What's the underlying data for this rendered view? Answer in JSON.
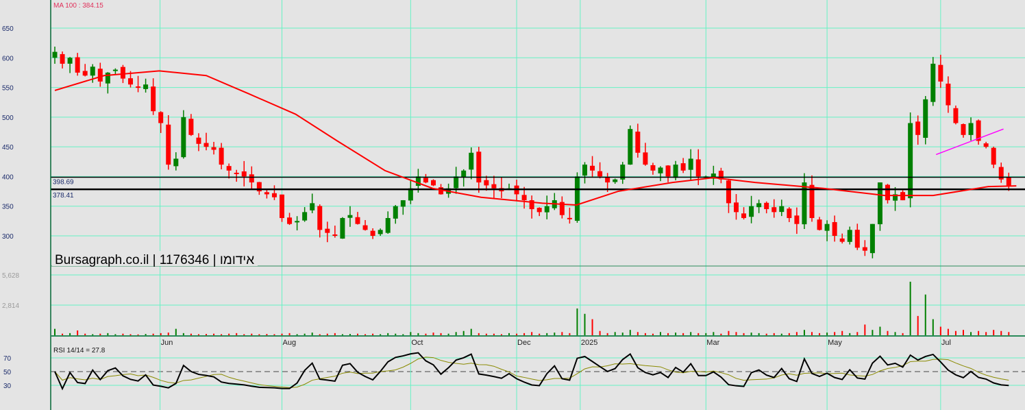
{
  "chart_data": {
    "type": "candlestick",
    "title": "Bursagraph.co.il | 1176346 | אידומו",
    "ma_label": "MA 100 : 384.15",
    "rsi_label": "RSI 14/14 = 27.8",
    "price_ticks": [
      650,
      600,
      550,
      500,
      450,
      400,
      350,
      300
    ],
    "ylim": [
      270,
      690
    ],
    "volume_ticks": [
      "5,628",
      "2,814"
    ],
    "volume_tick_values": [
      5628,
      2814
    ],
    "rsi_ticks": [
      70,
      50,
      30
    ],
    "date_labels": [
      {
        "label": "Jun",
        "index": 13.9
      },
      {
        "label": "Aug",
        "index": 30
      },
      {
        "label": "Oct",
        "index": 47
      },
      {
        "label": "Dec",
        "index": 61
      },
      {
        "label": "2025",
        "index": 69.4
      },
      {
        "label": "Mar",
        "index": 86
      },
      {
        "label": "May",
        "index": 102
      },
      {
        "label": "Jul",
        "index": 117
      }
    ],
    "levels": [
      {
        "label": "398.69",
        "value": 398.69
      },
      {
        "label": "378.41",
        "value": 378.41
      }
    ],
    "trendline": [
      [
        116.4,
        437
      ],
      [
        125.3,
        480
      ]
    ],
    "closes": [
      610,
      590,
      600,
      575,
      570,
      585,
      560,
      575,
      580,
      565,
      555,
      550,
      555,
      510,
      490,
      420,
      430,
      500,
      470,
      455,
      450,
      445,
      420,
      410,
      405,
      400,
      390,
      375,
      370,
      365,
      330,
      320,
      325,
      340,
      355,
      310,
      305,
      300,
      330,
      335,
      320,
      310,
      300,
      310,
      330,
      350,
      360,
      380,
      400,
      390,
      385,
      370,
      380,
      400,
      410,
      440,
      390,
      385,
      380,
      375,
      380,
      370,
      360,
      345,
      340,
      350,
      360,
      335,
      330,
      400,
      420,
      410,
      400,
      390,
      395,
      420,
      480,
      440,
      420,
      410,
      415,
      400,
      420,
      410,
      430,
      400,
      400,
      405,
      395,
      355,
      340,
      330,
      350,
      355,
      345,
      340,
      350,
      330,
      320,
      390,
      330,
      310,
      320,
      300,
      290,
      310,
      280,
      275,
      320,
      390,
      360,
      370,
      360,
      490,
      470,
      530,
      590,
      560,
      520,
      490,
      470,
      490,
      460,
      450,
      420,
      395,
      385
    ],
    "volumes": [
      600,
      150,
      200,
      450,
      150,
      100,
      150,
      200,
      100,
      150,
      100,
      80,
      120,
      150,
      200,
      250,
      600,
      200,
      150,
      100,
      120,
      150,
      100,
      150,
      200,
      100,
      150,
      100,
      120,
      100,
      150,
      200,
      100,
      150,
      250,
      100,
      150,
      200,
      100,
      120,
      150,
      100,
      150,
      100,
      200,
      150,
      100,
      300,
      200,
      150,
      250,
      200,
      150,
      300,
      400,
      600,
      200,
      150,
      150,
      100,
      200,
      150,
      200,
      300,
      150,
      200,
      250,
      300,
      200,
      2500,
      2000,
      1500,
      400,
      200,
      300,
      250,
      500,
      300,
      200,
      150,
      300,
      200,
      250,
      200,
      300,
      200,
      200,
      300,
      150,
      400,
      300,
      200,
      250,
      200,
      150,
      200,
      150,
      200,
      300,
      500,
      300,
      200,
      250,
      300,
      400,
      200,
      300,
      1000,
      500,
      800,
      400,
      300,
      200,
      5000,
      1800,
      3800,
      1500,
      800,
      600,
      400,
      500,
      300,
      400,
      300,
      500,
      400,
      300
    ],
    "ma100": [
      [
        0,
        545
      ],
      [
        6.5,
        570
      ],
      [
        13.8,
        578
      ],
      [
        20,
        570
      ],
      [
        25.5,
        540
      ],
      [
        31.8,
        505
      ],
      [
        37.3,
        460
      ],
      [
        43.6,
        410
      ],
      [
        49.9,
        380
      ],
      [
        56.3,
        365
      ],
      [
        64.4,
        355
      ],
      [
        68.9,
        352
      ],
      [
        74.4,
        375
      ],
      [
        81.6,
        390
      ],
      [
        87,
        398
      ],
      [
        92.5,
        390
      ],
      [
        101.5,
        380
      ],
      [
        109.6,
        368
      ],
      [
        116,
        368
      ],
      [
        123.3,
        383
      ],
      [
        127,
        384.15
      ]
    ]
  }
}
